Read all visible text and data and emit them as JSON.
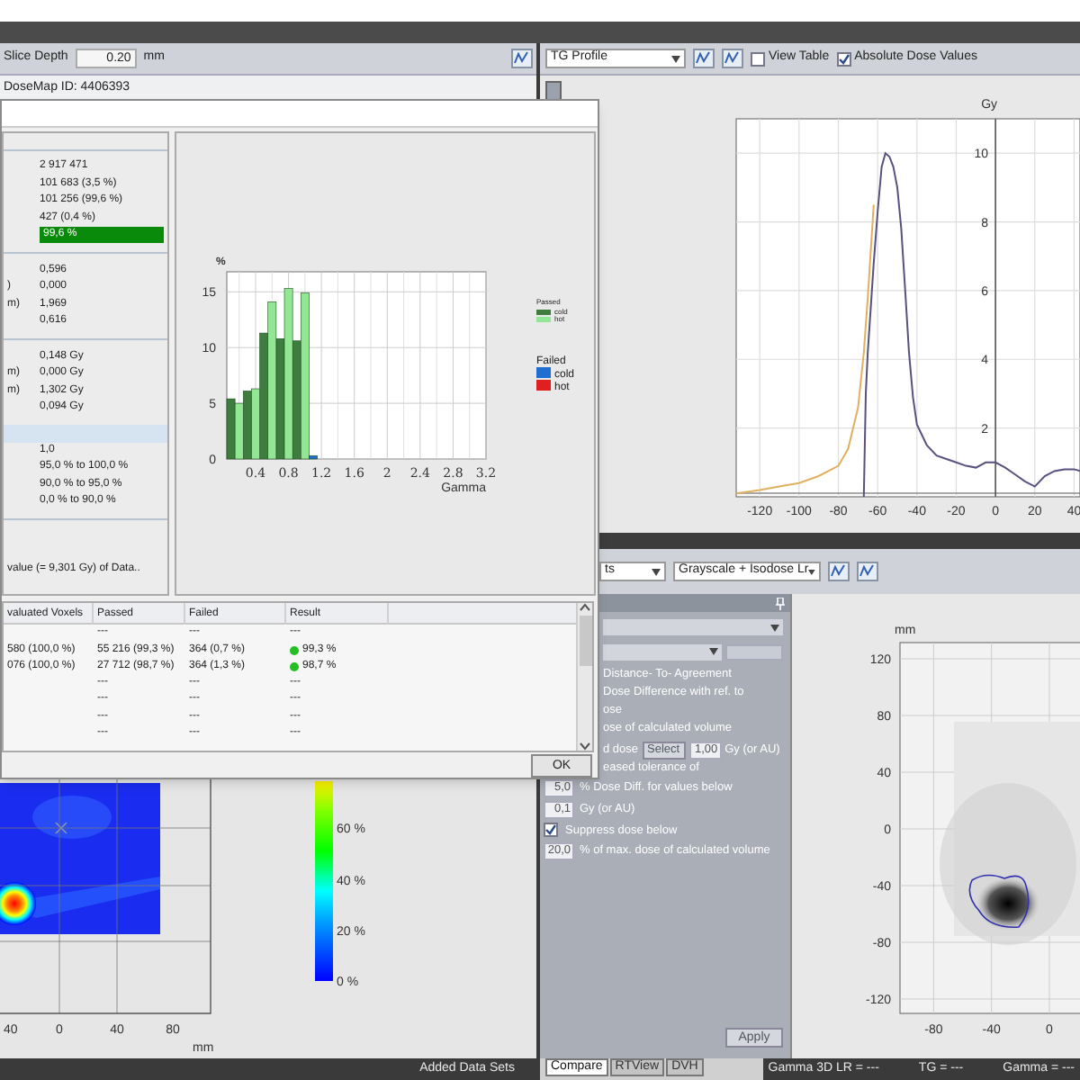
{
  "left_toolbar": {
    "label": "Slice Depth",
    "value": "0.20",
    "unit": "mm"
  },
  "dosemap_id": "DoseMap ID: 4406393",
  "dialog": {
    "stats": [
      {
        "kind": "rule"
      },
      {
        "kind": "value",
        "value": "2 917 471"
      },
      {
        "kind": "value",
        "value": "101 683 (3,5 %)"
      },
      {
        "kind": "value",
        "value": "101 256 (99,6 %)"
      },
      {
        "kind": "value",
        "value": "427 (0,4 %)"
      },
      {
        "kind": "result",
        "value": "99,6 %",
        "passed": true
      },
      {
        "kind": "rule"
      },
      {
        "kind": "value",
        "value": "0,596"
      },
      {
        "kind": "value",
        "label": ")",
        "value": "0,000"
      },
      {
        "kind": "value",
        "label": "m)",
        "value": "1,969"
      },
      {
        "kind": "value",
        "value": "0,616"
      },
      {
        "kind": "rule"
      },
      {
        "kind": "value",
        "value": "0,148 Gy"
      },
      {
        "kind": "value",
        "label": "m)",
        "value": "0,000 Gy"
      },
      {
        "kind": "value",
        "label": "m)",
        "value": "1,302 Gy"
      },
      {
        "kind": "value",
        "value": "0,094 Gy"
      },
      {
        "kind": "band"
      },
      {
        "kind": "value",
        "value": "1,0"
      },
      {
        "kind": "value",
        "value": "95,0 % to 100,0 %"
      },
      {
        "kind": "value",
        "value": "90,0 % to 95,0 %"
      },
      {
        "kind": "value",
        "value": "0,0 % to 90,0 %"
      },
      {
        "kind": "rule"
      },
      {
        "kind": "note",
        "value": "value (= 9,301 Gy) of Data.."
      }
    ],
    "histogram": {
      "chart_data": {
        "type": "bar",
        "xlabel": "Gamma",
        "ylabel": "%",
        "x": [
          0.1,
          0.2,
          0.3,
          0.4,
          0.5,
          0.6,
          0.7,
          0.8,
          0.9,
          1.0,
          1.1
        ],
        "series": [
          {
            "color": "#3d7d3d",
            "values": [
              5.4,
              null,
              6.1,
              null,
              11.3,
              null,
              10.8,
              null,
              10.6,
              null,
              null
            ]
          },
          {
            "color": "#93e693",
            "values": [
              null,
              5.0,
              null,
              6.3,
              null,
              14.1,
              null,
              15.3,
              null,
              14.9,
              null
            ]
          },
          {
            "color": "#1f6fd0",
            "values": [
              null,
              null,
              null,
              null,
              null,
              null,
              null,
              null,
              null,
              null,
              0.3
            ]
          },
          {
            "color": "#e02020",
            "values": [
              null,
              null,
              null,
              null,
              null,
              null,
              null,
              null,
              null,
              null,
              null
            ]
          }
        ],
        "xlim": [
          0.05,
          3.2
        ],
        "ylim": [
          0,
          16.8
        ],
        "xticks": [
          0.4,
          0.8,
          1.2,
          1.6,
          2,
          2.4,
          2.8,
          3.2
        ],
        "yticks": [
          0,
          5,
          10,
          15
        ],
        "grid": true
      },
      "legend": [
        {
          "title": "Passed",
          "items": [
            {
              "label": "cold",
              "color": "#3d7d3d"
            },
            {
              "label": "hot",
              "color": "#93e693"
            }
          ]
        },
        {
          "title": "Failed",
          "items": [
            {
              "label": "cold",
              "color": "#1f6fd0"
            },
            {
              "label": "hot",
              "color": "#e02020"
            }
          ]
        }
      ]
    },
    "table": {
      "columns": [
        "valuated Voxels",
        "Passed",
        "Failed",
        "Result"
      ],
      "rows": [
        {
          "passed": "---",
          "failed": "---",
          "result": "---"
        },
        {
          "voxels": "580 (100,0 %)",
          "passed": "55 216 (99,3 %)",
          "failed": "364 (0,7 %)",
          "result": "99,3 %",
          "pass": true
        },
        {
          "voxels": "076 (100,0 %)",
          "passed": "27 712 (98,7 %)",
          "failed": "364 (1,3 %)",
          "result": "98,7 %",
          "pass": true
        },
        {
          "passed": "---",
          "failed": "---",
          "result": "---"
        },
        {
          "passed": "---",
          "failed": "---",
          "result": "---"
        },
        {
          "passed": "---",
          "failed": "---",
          "result": "---"
        },
        {
          "passed": "---",
          "failed": "---",
          "result": "---"
        }
      ]
    },
    "ok_button": "OK"
  },
  "right_toolbar": {
    "profile_select": "TG Profile",
    "view_table": {
      "label": "View Table",
      "checked": false
    },
    "absolute_dose": {
      "label": "Absolute Dose Values",
      "checked": true
    }
  },
  "profile": {
    "chart_data": {
      "type": "line",
      "ylabel": "Gy",
      "x": [
        -132,
        -120,
        -110,
        -100,
        -90,
        -80,
        -75,
        -70,
        -67,
        -66,
        -65,
        -62,
        -60,
        -58,
        -56,
        -54,
        -52,
        -50,
        -48,
        -46,
        -44,
        -42,
        -40,
        -35,
        -30,
        -25,
        -20,
        -15,
        -10,
        -5,
        0,
        5,
        10,
        15,
        20,
        25,
        30,
        35,
        40,
        43
      ],
      "series": [
        {
          "color": "#e0b060",
          "values": [
            0.1,
            0.2,
            0.3,
            0.4,
            0.6,
            0.9,
            1.4,
            2.6,
            4.2,
            5.0,
            5.8,
            8.5,
            null,
            null,
            null,
            null,
            null,
            null,
            null,
            null,
            null,
            null,
            null,
            null,
            null,
            null,
            null,
            null,
            null,
            null,
            null,
            null,
            null,
            null,
            null,
            null,
            null,
            null,
            null,
            null
          ]
        },
        {
          "color": "#5a5080",
          "values": [
            null,
            null,
            null,
            null,
            null,
            null,
            null,
            null,
            0.0,
            3.0,
            4.2,
            6.8,
            8.3,
            9.6,
            10.0,
            9.9,
            9.6,
            9.0,
            7.8,
            6.0,
            4.2,
            2.9,
            2.1,
            1.5,
            1.2,
            1.1,
            1.0,
            0.9,
            0.85,
            1.0,
            1.0,
            0.85,
            0.65,
            0.45,
            0.3,
            0.6,
            0.75,
            0.8,
            0.8,
            0.75
          ]
        }
      ],
      "xlim": [
        -132,
        43
      ],
      "ylim": [
        0,
        11
      ],
      "xticks": [
        -120,
        -100,
        -80,
        -60,
        -40,
        -20,
        0,
        20,
        40
      ],
      "yticks": [
        2,
        4,
        6,
        8,
        10
      ],
      "grid": true
    }
  },
  "lower_toolbar": {
    "dataset_select": "ts",
    "display_select": "Grayscale + Isodose Lr"
  },
  "settings": {
    "rows": [
      {
        "kind": "dropdown"
      },
      {
        "kind": "dropdown_button"
      },
      {
        "kind": "text",
        "text": "Distance- To- Agreement"
      },
      {
        "kind": "text",
        "text": "Dose Difference with ref. to"
      },
      {
        "kind": "text",
        "text": "ose"
      },
      {
        "kind": "text",
        "text": "ose of calculated volume"
      },
      {
        "kind": "select_row",
        "text": "d dose",
        "button": "Select",
        "value": "1,00",
        "unit": "Gy (or AU)"
      },
      {
        "kind": "text",
        "text": "eased tolerance of"
      },
      {
        "kind": "input_row",
        "value": "5,0",
        "text": "% Dose Diff. for values below"
      },
      {
        "kind": "input_row",
        "value": "0,1",
        "text": "Gy (or AU)"
      },
      {
        "kind": "checkbox_row",
        "checked": true,
        "text": "Suppress dose below"
      },
      {
        "kind": "input_row",
        "value": "20,0",
        "text": "% of max. dose of calculated volume"
      }
    ],
    "apply": "Apply",
    "tabs": [
      {
        "label": "Compare",
        "selected": true
      },
      {
        "label": "RTView",
        "selected": false
      },
      {
        "label": "DVH",
        "selected": false
      }
    ]
  },
  "dose_map": {
    "unit": "mm",
    "y_labels": [
      "120",
      "80",
      "40",
      "0",
      "-40",
      "-80",
      "-120"
    ],
    "x_labels": [
      "-80",
      "-40",
      "0"
    ]
  },
  "gamma_map": {
    "x_labels": [
      "40",
      "0",
      "40",
      "80"
    ],
    "unit": "mm",
    "scale_labels": [
      "60 %",
      "40 %",
      "20 %",
      "0 %"
    ]
  },
  "left_status": "Added Data Sets",
  "right_status": [
    "Gamma 3D LR = ---",
    "TG = ---",
    "Gamma = ---"
  ]
}
